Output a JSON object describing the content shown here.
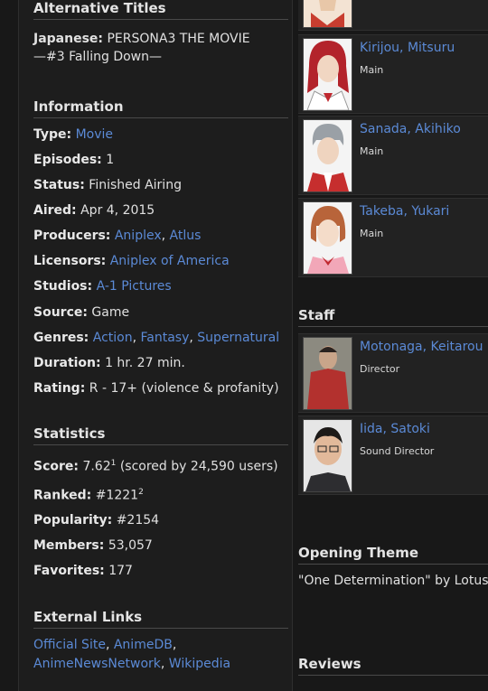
{
  "alt_titles": {
    "heading": "Alternative Titles",
    "japanese_label": "Japanese:",
    "japanese_value_line1": "PERSONA3 THE MOVIE",
    "japanese_value_line2": "—#3 Falling Down—"
  },
  "information": {
    "heading": "Information",
    "type_label": "Type:",
    "type_value": "Movie",
    "episodes_label": "Episodes:",
    "episodes_value": "1",
    "status_label": "Status:",
    "status_value": "Finished Airing",
    "aired_label": "Aired:",
    "aired_value": "Apr 4, 2015",
    "producers_label": "Producers:",
    "producers": [
      "Aniplex",
      "Atlus"
    ],
    "licensors_label": "Licensors:",
    "licensors": [
      "Aniplex of America"
    ],
    "studios_label": "Studios:",
    "studios": [
      "A-1 Pictures"
    ],
    "source_label": "Source:",
    "source_value": "Game",
    "genres_label": "Genres:",
    "genres": [
      "Action",
      "Fantasy",
      "Supernatural"
    ],
    "duration_label": "Duration:",
    "duration_value": "1 hr. 27 min.",
    "rating_label": "Rating:",
    "rating_value": "R - 17+ (violence & profanity)"
  },
  "statistics": {
    "heading": "Statistics",
    "score_label": "Score:",
    "score_value": "7.62",
    "score_sup": "1",
    "score_detail": "(scored by 24,590 users)",
    "ranked_label": "Ranked:",
    "ranked_value": "#1221",
    "ranked_sup": "2",
    "popularity_label": "Popularity:",
    "popularity_value": "#2154",
    "members_label": "Members:",
    "members_value": "53,057",
    "favorites_label": "Favorites:",
    "favorites_value": "177"
  },
  "external_links": {
    "heading": "External Links",
    "links": [
      "Official Site",
      "AnimeDB",
      "AnimeNewsNetwork",
      "Wikipedia"
    ]
  },
  "characters": [
    {
      "name": "Kirijou, Mitsuru",
      "role": "Main",
      "hair": "#b3232b",
      "outfit": "#ffffff"
    },
    {
      "name": "Sanada, Akihiko",
      "role": "Main",
      "hair": "#9aa0a6",
      "outfit": "#c62e2e"
    },
    {
      "name": "Takeba, Yukari",
      "role": "Main",
      "hair": "#b8643a",
      "outfit": "#f2a7b8"
    }
  ],
  "staff": {
    "heading": "Staff",
    "members": [
      {
        "name": "Motonaga, Keitarou",
        "role": "Director"
      },
      {
        "name": "Iida, Satoki",
        "role": "Sound Director"
      }
    ]
  },
  "opening_theme": {
    "heading": "Opening Theme",
    "text": "\"One Determination\" by Lotus"
  },
  "reviews": {
    "heading": "Reviews"
  }
}
